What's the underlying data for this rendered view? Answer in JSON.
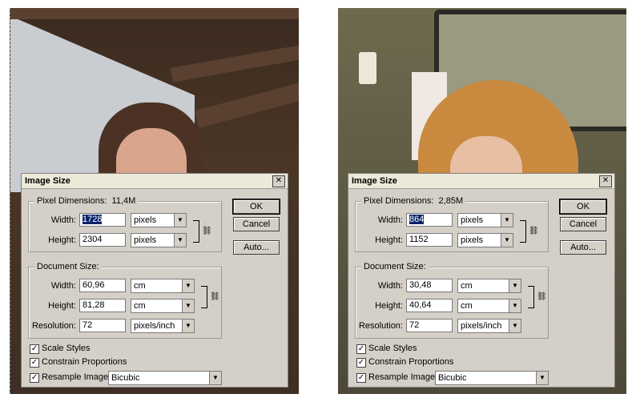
{
  "left": {
    "title": "Image Size",
    "close": "✕",
    "pixel_dimensions": {
      "label": "Pixel Dimensions:",
      "size": "11,4M",
      "width_label": "Width:",
      "width_value": "1728",
      "width_unit": "pixels",
      "height_label": "Height:",
      "height_value": "2304",
      "height_unit": "pixels"
    },
    "document_size": {
      "label": "Document Size:",
      "width_label": "Width:",
      "width_value": "60,96",
      "width_unit": "cm",
      "height_label": "Height:",
      "height_value": "81,28",
      "height_unit": "cm",
      "resolution_label": "Resolution:",
      "resolution_value": "72",
      "resolution_unit": "pixels/inch"
    },
    "buttons": {
      "ok": "OK",
      "cancel": "Cancel",
      "auto": "Auto..."
    },
    "checkboxes": {
      "scale_styles": "Scale Styles",
      "constrain": "Constrain Proportions",
      "resample": "Resample Image:"
    },
    "resample_value": "Bicubic"
  },
  "right": {
    "title": "Image Size",
    "close": "✕",
    "pixel_dimensions": {
      "label": "Pixel Dimensions:",
      "size": "2,85M",
      "width_label": "Width:",
      "width_value": "864",
      "width_unit": "pixels",
      "height_label": "Height:",
      "height_value": "1152",
      "height_unit": "pixels"
    },
    "document_size": {
      "label": "Document Size:",
      "width_label": "Width:",
      "width_value": "30,48",
      "width_unit": "cm",
      "height_label": "Height:",
      "height_value": "40,64",
      "height_unit": "cm",
      "resolution_label": "Resolution:",
      "resolution_value": "72",
      "resolution_unit": "pixels/inch"
    },
    "buttons": {
      "ok": "OK",
      "cancel": "Cancel",
      "auto": "Auto..."
    },
    "checkboxes": {
      "scale_styles": "Scale Styles",
      "constrain": "Constrain Proportions",
      "resample": "Resample Image:"
    },
    "resample_value": "Bicubic"
  },
  "icons": {
    "dropdown": "chevron-down-icon",
    "link": "chain-link-icon",
    "check": "checkmark-icon"
  }
}
